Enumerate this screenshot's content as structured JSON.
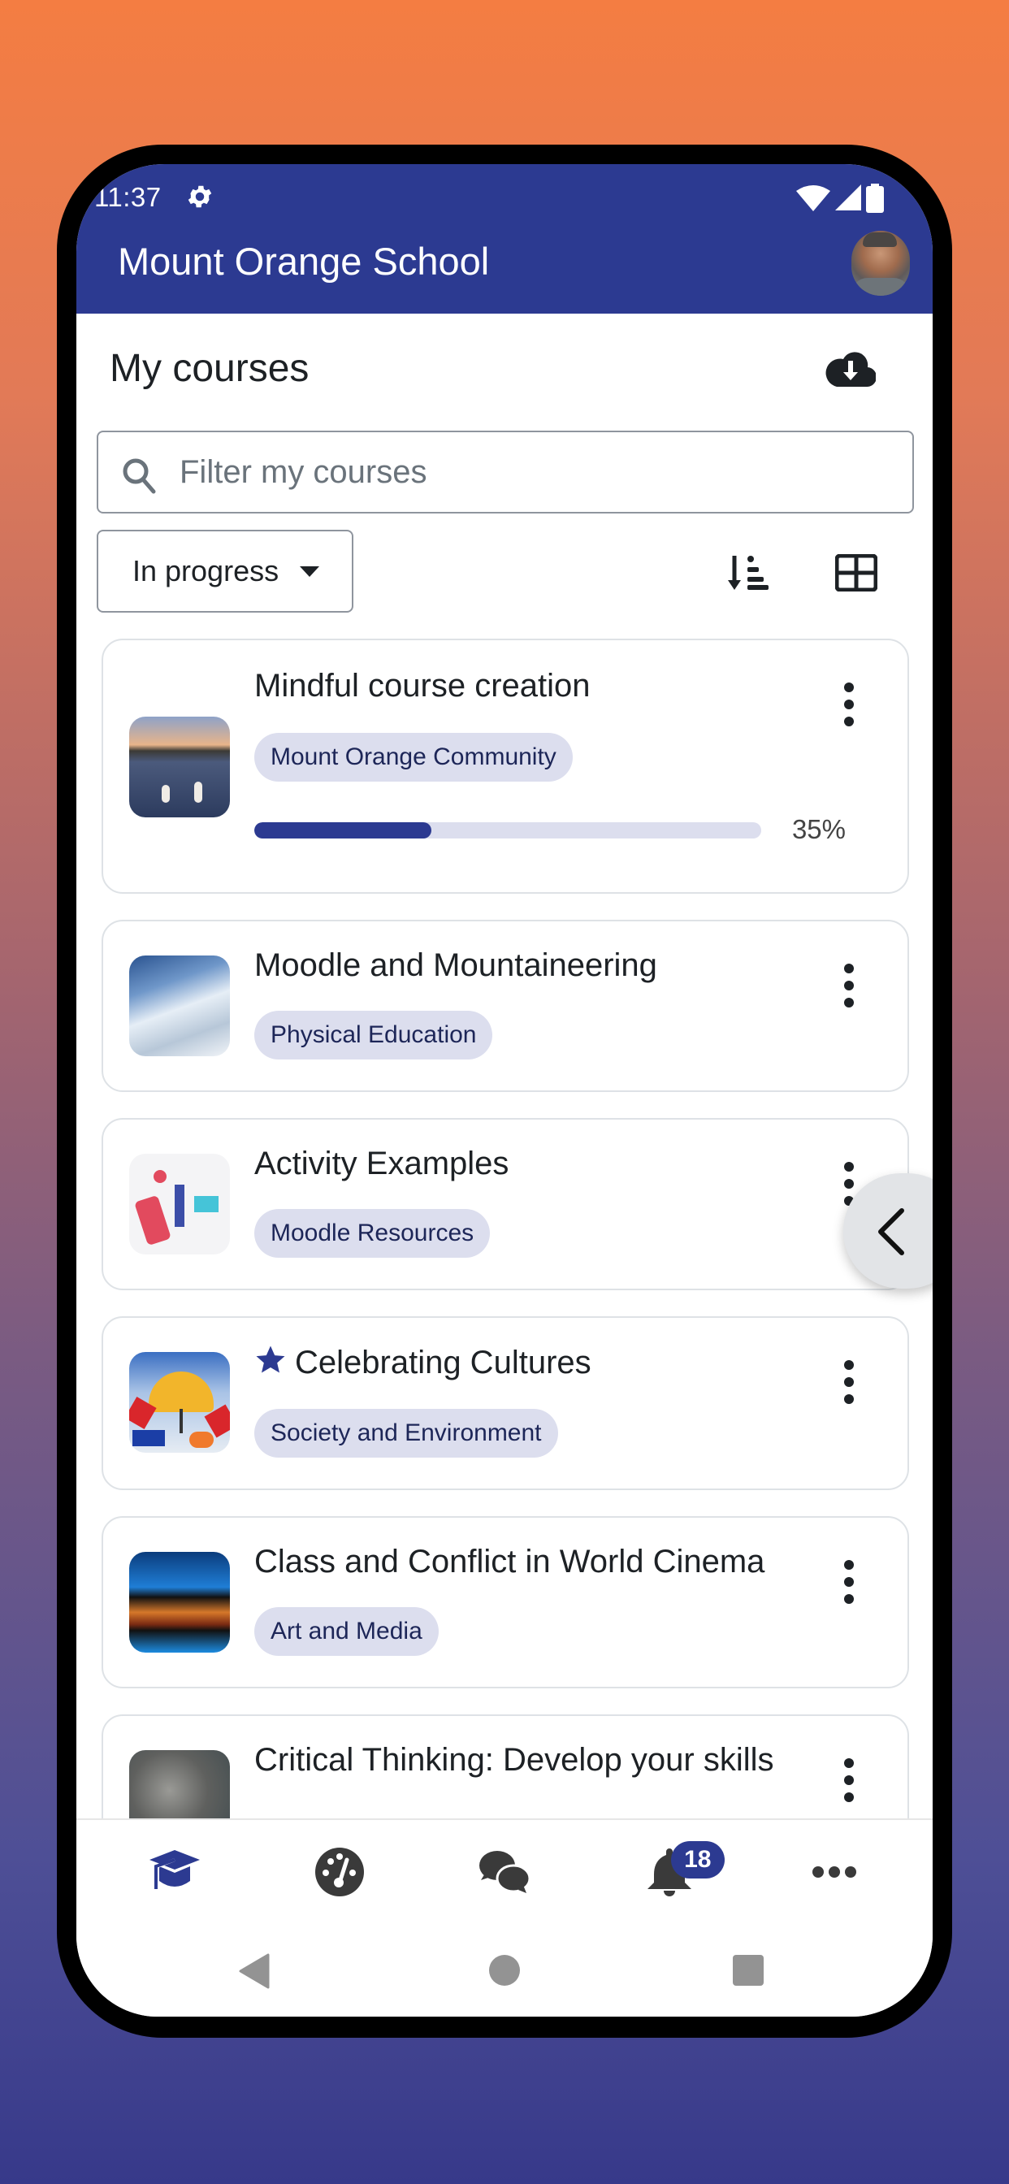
{
  "status_bar": {
    "time": "11:37",
    "icons": [
      "settings-gear-icon",
      "wifi-icon",
      "cell-signal-icon",
      "battery-icon"
    ]
  },
  "app_bar": {
    "title": "Mount Orange School",
    "avatar": "user-avatar"
  },
  "page": {
    "title": "My courses",
    "download_icon": "cloud-download-icon"
  },
  "search": {
    "placeholder": "Filter my courses",
    "value": ""
  },
  "filter": {
    "selected": "In progress"
  },
  "view_controls": {
    "sort_icon": "sort-descending-icon",
    "layout_icon": "grid-view-icon"
  },
  "colors": {
    "brand": "#2c3a91",
    "category_bg": "#dcdeee",
    "category_text": "#1d2658",
    "text": "#1d2125"
  },
  "courses": [
    {
      "name": "Mindful course creation",
      "category": "Mount Orange Community",
      "progress_percent": 35,
      "progress_label": "35%",
      "starred": false,
      "image": "swans-lake"
    },
    {
      "name": "Moodle and Mountaineering",
      "category": "Physical Education",
      "starred": false,
      "image": "snowy-mountain"
    },
    {
      "name": "Activity Examples",
      "category": "Moodle Resources",
      "starred": false,
      "image": "people-illustration"
    },
    {
      "name": "Celebrating Cultures",
      "category": "Society and Environment",
      "starred": true,
      "image": "umbrellas"
    },
    {
      "name": "Class and Conflict in World Cinema",
      "category": "Art and Media",
      "starred": false,
      "image": "film-strip"
    },
    {
      "name": "Critical Thinking: Develop your skills",
      "category": "",
      "starred": false,
      "image": "statue"
    }
  ],
  "tabbar": {
    "items": [
      {
        "name": "My courses",
        "icon": "graduation-cap-icon",
        "active": true
      },
      {
        "name": "Dashboard",
        "icon": "dashboard-gauge-icon",
        "active": false
      },
      {
        "name": "Messages",
        "icon": "chat-bubbles-icon",
        "active": false
      },
      {
        "name": "Notifications",
        "icon": "bell-icon",
        "active": false,
        "badge": "18"
      },
      {
        "name": "More",
        "icon": "more-horizontal-icon",
        "active": false
      }
    ]
  }
}
